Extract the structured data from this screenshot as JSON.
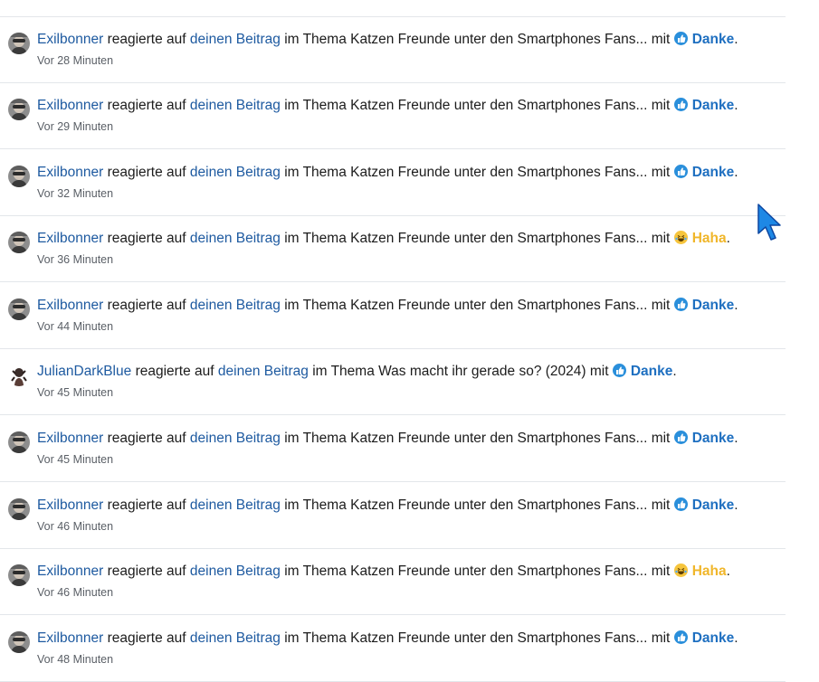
{
  "feed": {
    "items": [
      {
        "user": "Exilbonner",
        "avatar": "exilbonner",
        "verb": "reagierte auf",
        "post_link": "deinen Beitrag",
        "context": "im Thema Katzen Freunde unter den Smartphones Fans... mit",
        "reaction": "Danke",
        "reaction_type": "like",
        "period": ".",
        "time": "Vor 28 Minuten"
      },
      {
        "user": "Exilbonner",
        "avatar": "exilbonner",
        "verb": "reagierte auf",
        "post_link": "deinen Beitrag",
        "context": "im Thema Katzen Freunde unter den Smartphones Fans... mit",
        "reaction": "Danke",
        "reaction_type": "like",
        "period": ".",
        "time": "Vor 29 Minuten"
      },
      {
        "user": "Exilbonner",
        "avatar": "exilbonner",
        "verb": "reagierte auf",
        "post_link": "deinen Beitrag",
        "context": "im Thema Katzen Freunde unter den Smartphones Fans... mit",
        "reaction": "Danke",
        "reaction_type": "like",
        "period": ".",
        "time": "Vor 32 Minuten"
      },
      {
        "user": "Exilbonner",
        "avatar": "exilbonner",
        "verb": "reagierte auf",
        "post_link": "deinen Beitrag",
        "context": "im Thema Katzen Freunde unter den Smartphones Fans... mit",
        "reaction": "Haha",
        "reaction_type": "haha",
        "period": ".",
        "time": "Vor 36 Minuten"
      },
      {
        "user": "Exilbonner",
        "avatar": "exilbonner",
        "verb": "reagierte auf",
        "post_link": "deinen Beitrag",
        "context": "im Thema Katzen Freunde unter den Smartphones Fans... mit",
        "reaction": "Danke",
        "reaction_type": "like",
        "period": ".",
        "time": "Vor 44 Minuten"
      },
      {
        "user": "JulianDarkBlue",
        "avatar": "julian",
        "verb": "reagierte auf",
        "post_link": "deinen Beitrag",
        "context": "im Thema Was macht ihr gerade so? (2024) mit",
        "reaction": "Danke",
        "reaction_type": "like",
        "period": ".",
        "time": "Vor 45 Minuten"
      },
      {
        "user": "Exilbonner",
        "avatar": "exilbonner",
        "verb": "reagierte auf",
        "post_link": "deinen Beitrag",
        "context": "im Thema Katzen Freunde unter den Smartphones Fans... mit",
        "reaction": "Danke",
        "reaction_type": "like",
        "period": ".",
        "time": "Vor 45 Minuten"
      },
      {
        "user": "Exilbonner",
        "avatar": "exilbonner",
        "verb": "reagierte auf",
        "post_link": "deinen Beitrag",
        "context": "im Thema Katzen Freunde unter den Smartphones Fans... mit",
        "reaction": "Danke",
        "reaction_type": "like",
        "period": ".",
        "time": "Vor 46 Minuten"
      },
      {
        "user": "Exilbonner",
        "avatar": "exilbonner",
        "verb": "reagierte auf",
        "post_link": "deinen Beitrag",
        "context": "im Thema Katzen Freunde unter den Smartphones Fans... mit",
        "reaction": "Haha",
        "reaction_type": "haha",
        "period": ".",
        "time": "Vor 46 Minuten"
      },
      {
        "user": "Exilbonner",
        "avatar": "exilbonner",
        "verb": "reagierte auf",
        "post_link": "deinen Beitrag",
        "context": "im Thema Katzen Freunde unter den Smartphones Fans... mit",
        "reaction": "Danke",
        "reaction_type": "like",
        "period": ".",
        "time": "Vor 48 Minuten"
      }
    ]
  },
  "colors": {
    "link": "#1e5aa0",
    "like": "#2a8fdb",
    "haha": "#f6c53d",
    "divider": "#e3e6ea"
  }
}
